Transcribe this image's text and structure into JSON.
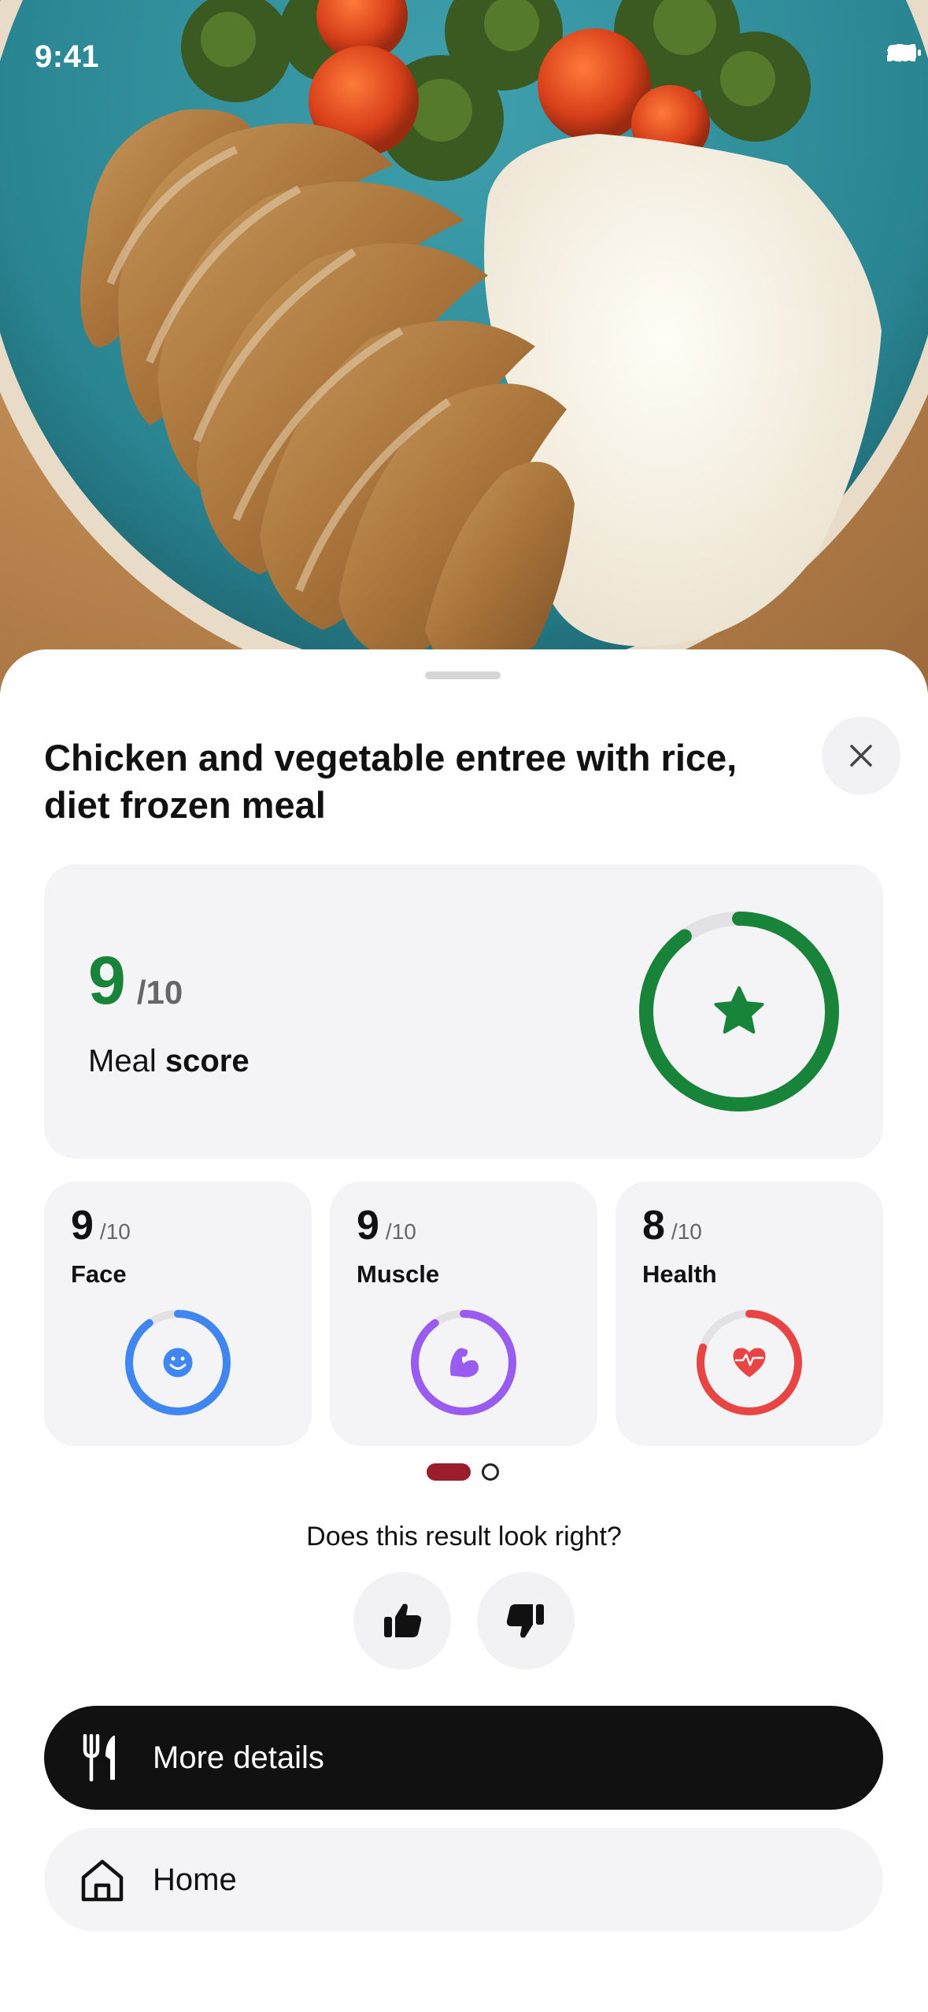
{
  "status_bar": {
    "time": "9:41"
  },
  "meal": {
    "title": "Chicken and vegetable entree with rice, diet frozen meal",
    "close_icon": "close-icon"
  },
  "meal_score": {
    "value": "9",
    "out_of": "/10",
    "label_prefix": "Meal",
    "label_bold": "score",
    "progress": 0.9,
    "color": "#17843a",
    "icon": "star-icon"
  },
  "sub_scores": [
    {
      "value": "9",
      "out_of": "/10",
      "label": "Face",
      "progress": 0.9,
      "color": "#3f86f0",
      "icon": "smiley-icon"
    },
    {
      "value": "9",
      "out_of": "/10",
      "label": "Muscle",
      "progress": 0.9,
      "color": "#9a5cf0",
      "icon": "flexed-arm-icon"
    },
    {
      "value": "8",
      "out_of": "/10",
      "label": "Health",
      "progress": 0.8,
      "color": "#e84444",
      "icon": "heart-pulse-icon"
    }
  ],
  "pagination": {
    "active_color": "#9b1d2b",
    "page_index": 1,
    "page_count": 2
  },
  "feedback": {
    "question": "Does this result look right?",
    "like_icon": "thumbs-up-icon",
    "dislike_icon": "thumbs-down-icon"
  },
  "actions": {
    "more_details_label": "More details",
    "more_details_icon": "fork-knife-icon",
    "home_label": "Home",
    "home_icon": "home-icon"
  }
}
